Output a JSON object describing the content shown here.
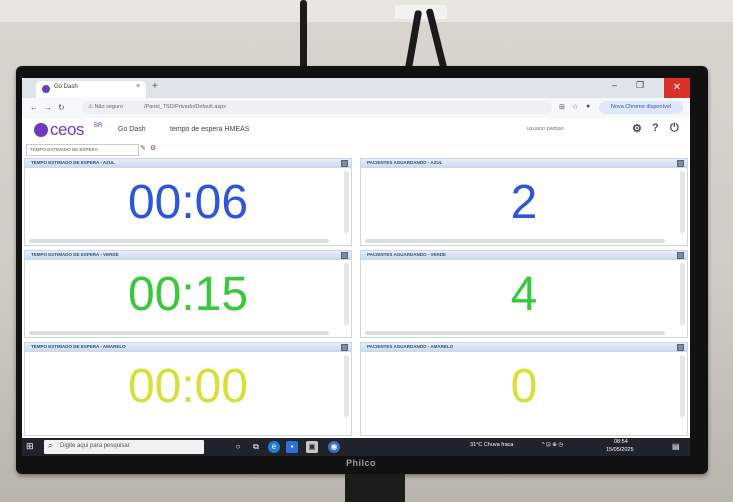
{
  "browser": {
    "tab_title": "Go Dash",
    "tab_close": "×",
    "new_tab": "+",
    "win_min": "–",
    "win_max": "❐",
    "win_close": "✕",
    "url_warning": "⚠ Não seguro",
    "url_text": "/Panel_TSD/Privado/Default.aspx",
    "update_label": "Nova Chrome disponível"
  },
  "app": {
    "logo": "ceos",
    "logo_sup": "BR",
    "nav_go_dash": "Go Dash",
    "nav_tempo": "tempo de espera HMEAS",
    "user": "usuario padrao",
    "breadcrumb": "TEMPO ESTIMADO DE ESPERA"
  },
  "panels": [
    {
      "title": "TEMPO ESTIMADO DE ESPERA - AZUL",
      "value": "00:06",
      "color": "#2b57d8"
    },
    {
      "title": "PACIENTES AGUARDANDO - AZUL",
      "value": "2",
      "color": "#2b57d8"
    },
    {
      "title": "TEMPO ESTIMADO DE ESPERA - VERDE",
      "value": "00:15",
      "color": "#37c93a"
    },
    {
      "title": "PACIENTES AGUARDANDO - VERDE",
      "value": "4",
      "color": "#37c93a"
    },
    {
      "title": "TEMPO ESTIMADO DE ESPERA - AMARELO",
      "value": "00:00",
      "color": "#d7df3a"
    },
    {
      "title": "PACIENTES AGUARDANDO - AMARELO",
      "value": "0",
      "color": "#d7df3a"
    }
  ],
  "taskbar": {
    "search_placeholder": "Digite aqui para pesquisar",
    "weather": "31°C Chuva fraca",
    "time": "08:54",
    "date": "15/05/2025"
  },
  "tv": {
    "brand": "Philco"
  }
}
